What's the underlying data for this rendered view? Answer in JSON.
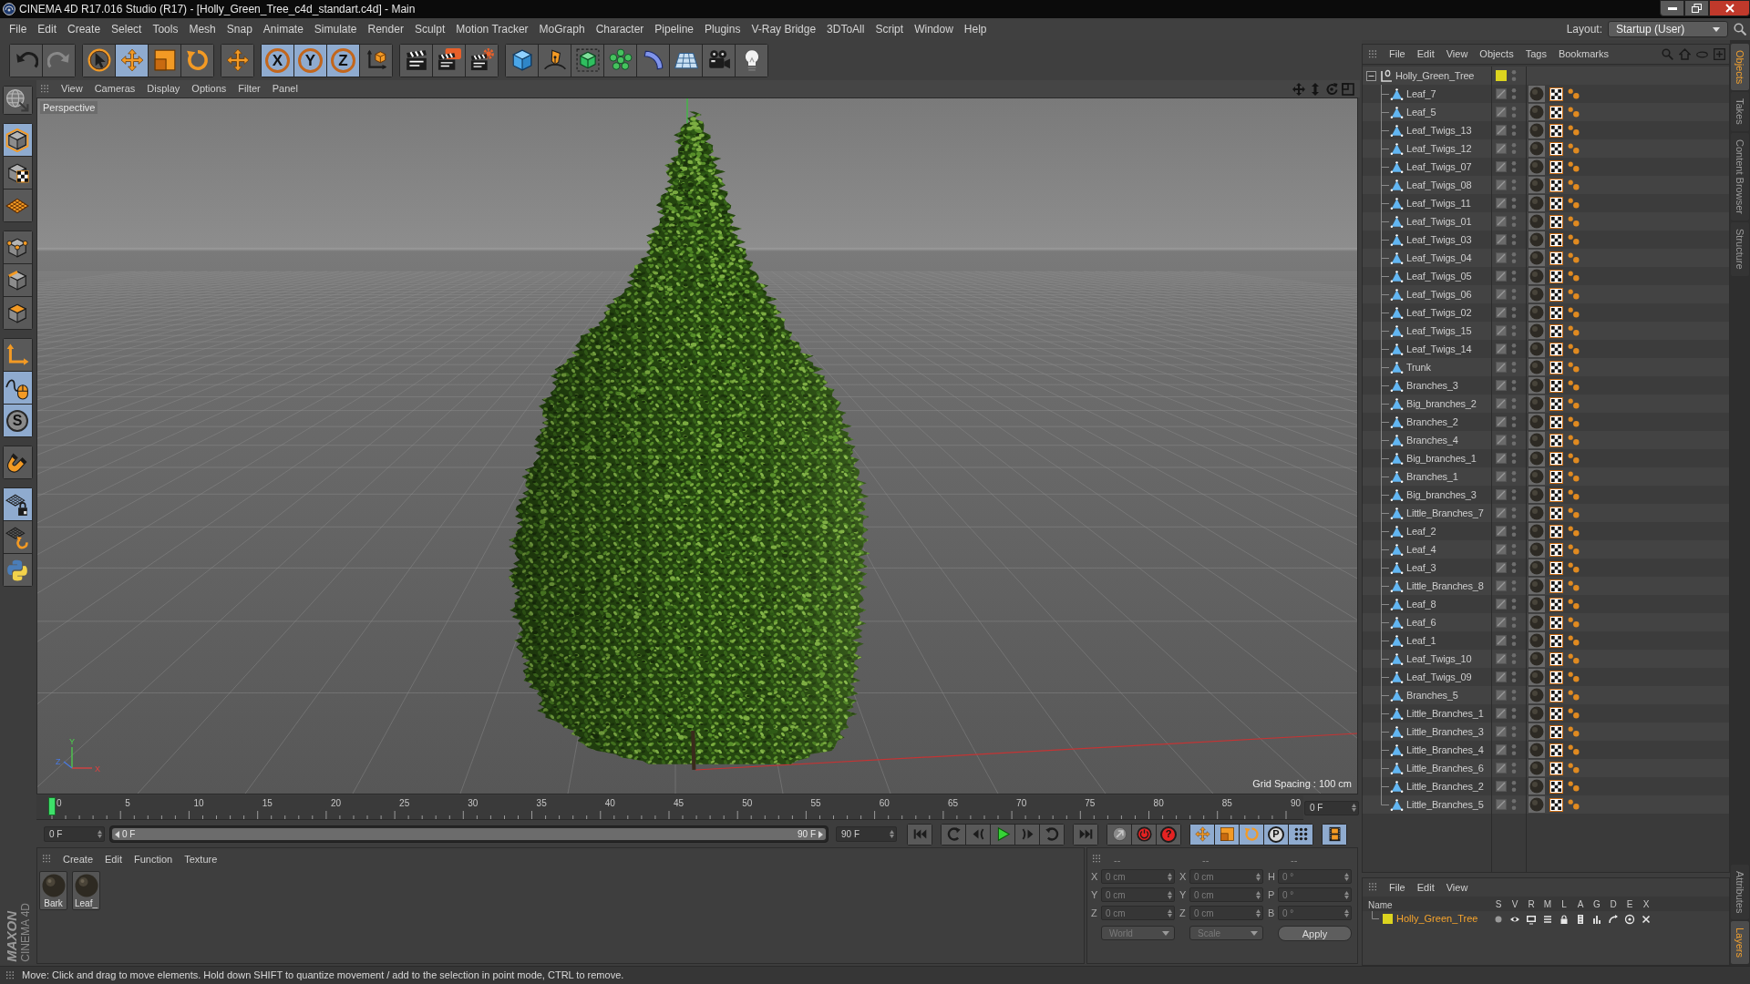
{
  "window": {
    "title": "CINEMA 4D R17.016 Studio (R17) - [Holly_Green_Tree_c4d_standart.c4d] - Main"
  },
  "menu": [
    "File",
    "Edit",
    "Create",
    "Select",
    "Tools",
    "Mesh",
    "Snap",
    "Animate",
    "Simulate",
    "Render",
    "Sculpt",
    "Motion Tracker",
    "MoGraph",
    "Character",
    "Pipeline",
    "Plugins",
    "V-Ray Bridge",
    "3DToAll",
    "Script",
    "Window",
    "Help"
  ],
  "layout": {
    "label": "Layout:",
    "value": "Startup (User)"
  },
  "toolbar": [
    [
      {
        "kind": "undo",
        "active": false,
        "disabled": false
      },
      {
        "kind": "redo",
        "active": false,
        "disabled": true
      }
    ],
    [
      {
        "kind": "select",
        "active": false,
        "disabled": false
      },
      {
        "kind": "move",
        "active": true,
        "disabled": false
      },
      {
        "kind": "scale",
        "active": false,
        "disabled": false
      },
      {
        "kind": "rotate",
        "active": false,
        "disabled": false
      }
    ],
    [
      {
        "kind": "transform",
        "active": false,
        "disabled": false
      }
    ],
    [
      {
        "kind": "axis-lock",
        "glyph": "X",
        "active": true,
        "disabled": false
      },
      {
        "kind": "axis-lock",
        "glyph": "Y",
        "active": true,
        "disabled": false
      },
      {
        "kind": "axis-lock",
        "glyph": "Z",
        "active": true,
        "disabled": false
      },
      {
        "kind": "coordinates",
        "active": false,
        "disabled": false
      }
    ],
    [
      {
        "kind": "render-view",
        "active": false,
        "disabled": false
      },
      {
        "kind": "render",
        "active": false,
        "disabled": false
      },
      {
        "kind": "render-settings",
        "active": false,
        "disabled": false
      }
    ],
    [
      {
        "kind": "cube",
        "active": false,
        "disabled": false
      },
      {
        "kind": "pen",
        "active": false,
        "disabled": false
      },
      {
        "kind": "subdivision",
        "active": false,
        "disabled": false
      },
      {
        "kind": "cloner",
        "active": false,
        "disabled": false
      },
      {
        "kind": "deformer",
        "active": false,
        "disabled": false
      },
      {
        "kind": "floor",
        "active": false,
        "disabled": false
      },
      {
        "kind": "camera",
        "active": false,
        "disabled": false
      },
      {
        "kind": "light",
        "active": false,
        "disabled": false
      }
    ]
  ],
  "tools": [
    [
      {
        "kind": "make-editable",
        "active": false
      }
    ],
    [
      {
        "kind": "model",
        "active": true
      },
      {
        "kind": "texture",
        "active": false
      },
      {
        "kind": "workplane",
        "active": false
      }
    ],
    [
      {
        "kind": "points",
        "active": false
      },
      {
        "kind": "edges",
        "active": false
      },
      {
        "kind": "polygons",
        "active": false
      }
    ],
    [
      {
        "kind": "axis",
        "active": false
      },
      {
        "kind": "tweak",
        "active": true
      },
      {
        "kind": "snap",
        "glyph": "S",
        "active": true
      }
    ],
    [
      {
        "kind": "magnet",
        "active": false
      }
    ],
    [
      {
        "kind": "lock-workplane",
        "active": true
      },
      {
        "kind": "grid-rotate",
        "active": false
      },
      {
        "kind": "python",
        "active": false
      }
    ]
  ],
  "viewport": {
    "menu": [
      "View",
      "Cameras",
      "Display",
      "Options",
      "Filter",
      "Panel"
    ],
    "camera": "Perspective",
    "gizmo_labels": [
      "Y",
      "Z",
      "X"
    ],
    "grid_spacing": "Grid Spacing : 100 cm"
  },
  "timeline": {
    "ticks": [
      "0",
      "5",
      "10",
      "15",
      "20",
      "25",
      "30",
      "35",
      "40",
      "45",
      "50",
      "55",
      "60",
      "65",
      "70",
      "75",
      "80",
      "85",
      "90"
    ],
    "level": 0,
    "frame": "0 F",
    "start": "0 F",
    "range": {
      "level": 1,
      "start": "0 F",
      "end": "90 F"
    },
    "end": "90 F"
  },
  "transport": [
    [
      {
        "kind": "go-start",
        "active": false
      }
    ],
    [
      {
        "kind": "loop-back",
        "active": false
      },
      {
        "kind": "prev-key",
        "active": false
      },
      {
        "kind": "play",
        "active": false
      },
      {
        "kind": "next-key",
        "active": false
      },
      {
        "kind": "loop-forward",
        "active": false
      }
    ],
    [
      {
        "kind": "go-end",
        "active": false
      }
    ],
    [
      {
        "kind": "keyframe",
        "active": false
      },
      {
        "kind": "record",
        "active": false
      },
      {
        "kind": "autokey",
        "glyph": "?",
        "active": false
      }
    ],
    [
      {
        "kind": "key-position",
        "active": true
      },
      {
        "kind": "key-scale",
        "active": true
      },
      {
        "kind": "key-rotation",
        "active": true
      },
      {
        "kind": "key-parameter",
        "glyph": "P",
        "active": true
      },
      {
        "kind": "key-pla",
        "active": true
      }
    ],
    [
      {
        "kind": "timeline",
        "active": true
      }
    ]
  ],
  "materials": {
    "menu": [
      "Create",
      "Edit",
      "Function",
      "Texture"
    ],
    "items": [
      {
        "name": "Bark"
      },
      {
        "name": "Leaf_"
      }
    ]
  },
  "coordinates": {
    "disabled": true,
    "headers": [
      "--",
      "--",
      "--"
    ],
    "rows": [
      [
        {
          "label": "X",
          "value": "0 cm"
        },
        {
          "label": "X",
          "value": "0 cm"
        },
        {
          "label": "H",
          "value": "0 °"
        }
      ],
      [
        {
          "label": "Y",
          "value": "0 cm"
        },
        {
          "label": "Y",
          "value": "0 cm"
        },
        {
          "label": "P",
          "value": "0 °"
        }
      ],
      [
        {
          "label": "Z",
          "value": "0 cm"
        },
        {
          "label": "Z",
          "value": "0 cm"
        },
        {
          "label": "B",
          "value": "0 °"
        }
      ]
    ],
    "dropdowns": [
      "World",
      "Scale"
    ],
    "apply": "Apply"
  },
  "logo": {
    "brand": "MAXON",
    "product": "CINEMA 4D"
  },
  "objects": {
    "menu": [
      "File",
      "Edit",
      "View",
      "Objects",
      "Tags",
      "Bookmarks"
    ],
    "tree": [
      {
        "name": "Holly_Green_Tree",
        "kind": "null",
        "color": "#dcd41f",
        "selected": false,
        "expanded": true,
        "children": [
          {
            "name": "Leaf_7",
            "kind": "polygon",
            "selected": false
          },
          {
            "name": "Leaf_5",
            "kind": "polygon",
            "selected": false
          },
          {
            "name": "Leaf_Twigs_13",
            "kind": "polygon",
            "selected": false
          },
          {
            "name": "Leaf_Twigs_12",
            "kind": "polygon",
            "selected": false
          },
          {
            "name": "Leaf_Twigs_07",
            "kind": "polygon",
            "selected": false
          },
          {
            "name": "Leaf_Twigs_08",
            "kind": "polygon",
            "selected": false
          },
          {
            "name": "Leaf_Twigs_11",
            "kind": "polygon",
            "selected": false
          },
          {
            "name": "Leaf_Twigs_01",
            "kind": "polygon",
            "selected": false
          },
          {
            "name": "Leaf_Twigs_03",
            "kind": "polygon",
            "selected": false
          },
          {
            "name": "Leaf_Twigs_04",
            "kind": "polygon",
            "selected": false
          },
          {
            "name": "Leaf_Twigs_05",
            "kind": "polygon",
            "selected": false
          },
          {
            "name": "Leaf_Twigs_06",
            "kind": "polygon",
            "selected": false
          },
          {
            "name": "Leaf_Twigs_02",
            "kind": "polygon",
            "selected": false
          },
          {
            "name": "Leaf_Twigs_15",
            "kind": "polygon",
            "selected": false
          },
          {
            "name": "Leaf_Twigs_14",
            "kind": "polygon",
            "selected": false
          },
          {
            "name": "Trunk",
            "kind": "polygon",
            "selected": false
          },
          {
            "name": "Branches_3",
            "kind": "polygon",
            "selected": false
          },
          {
            "name": "Big_branches_2",
            "kind": "polygon",
            "selected": false
          },
          {
            "name": "Branches_2",
            "kind": "polygon",
            "selected": false
          },
          {
            "name": "Branches_4",
            "kind": "polygon",
            "selected": false
          },
          {
            "name": "Big_branches_1",
            "kind": "polygon",
            "selected": false
          },
          {
            "name": "Branches_1",
            "kind": "polygon",
            "selected": false
          },
          {
            "name": "Big_branches_3",
            "kind": "polygon",
            "selected": false
          },
          {
            "name": "Little_Branches_7",
            "kind": "polygon",
            "selected": false
          },
          {
            "name": "Leaf_2",
            "kind": "polygon",
            "selected": false
          },
          {
            "name": "Leaf_4",
            "kind": "polygon",
            "selected": false
          },
          {
            "name": "Leaf_3",
            "kind": "polygon",
            "selected": false
          },
          {
            "name": "Little_Branches_8",
            "kind": "polygon",
            "selected": false
          },
          {
            "name": "Leaf_8",
            "kind": "polygon",
            "selected": false
          },
          {
            "name": "Leaf_6",
            "kind": "polygon",
            "selected": false
          },
          {
            "name": "Leaf_1",
            "kind": "polygon",
            "selected": false
          },
          {
            "name": "Leaf_Twigs_10",
            "kind": "polygon",
            "selected": false
          },
          {
            "name": "Leaf_Twigs_09",
            "kind": "polygon",
            "selected": false
          },
          {
            "name": "Branches_5",
            "kind": "polygon",
            "selected": false
          },
          {
            "name": "Little_Branches_1",
            "kind": "polygon",
            "selected": false
          },
          {
            "name": "Little_Branches_3",
            "kind": "polygon",
            "selected": false
          },
          {
            "name": "Little_Branches_4",
            "kind": "polygon",
            "selected": false
          },
          {
            "name": "Little_Branches_6",
            "kind": "polygon",
            "selected": false
          },
          {
            "name": "Little_Branches_2",
            "kind": "polygon",
            "selected": false
          },
          {
            "name": "Little_Branches_5",
            "kind": "polygon",
            "selected": false
          }
        ]
      }
    ]
  },
  "layers": {
    "menu": [
      "File",
      "Edit",
      "View"
    ],
    "columns": [
      "Name",
      "S",
      "V",
      "R",
      "M",
      "L",
      "A",
      "G",
      "D",
      "E",
      "X"
    ],
    "items": [
      {
        "name": "Holly_Green_Tree",
        "color": "#dcd41f",
        "selected": true
      }
    ]
  },
  "side_tabs": {
    "top": [
      {
        "label": "Objects",
        "selected": true
      },
      {
        "label": "Takes",
        "selected": false
      },
      {
        "label": "Content Browser",
        "selected": false
      },
      {
        "label": "Structure",
        "selected": false
      }
    ],
    "bottom": [
      {
        "label": "Attributes",
        "selected": false
      },
      {
        "label": "Layers",
        "selected": true
      }
    ]
  },
  "status_bar": "Move: Click and drag to move elements. Hold down SHIFT to quantize movement / add to the selection in point mode, CTRL to remove."
}
